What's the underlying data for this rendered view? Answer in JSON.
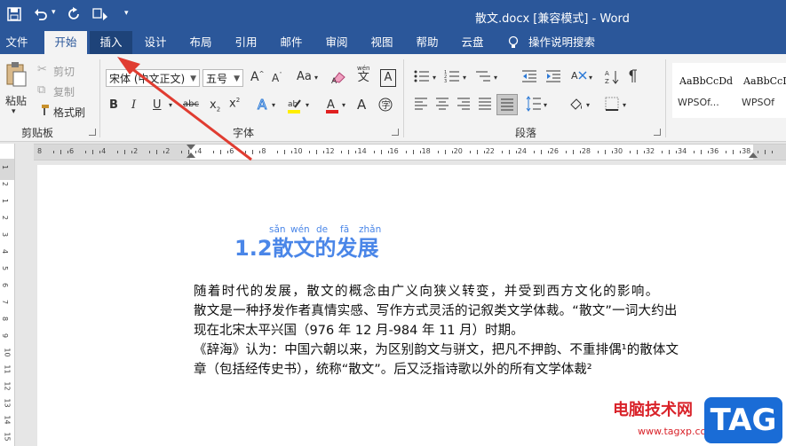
{
  "titlebar": {
    "title": "散文.docx [兼容模式] - Word",
    "save_icon": "save-icon",
    "undo_icon": "undo-icon",
    "redo_icon": "redo-icon"
  },
  "tabs": [
    "文件",
    "开始",
    "插入",
    "设计",
    "布局",
    "引用",
    "邮件",
    "审阅",
    "视图",
    "帮助",
    "云盘",
    "操作说明搜索"
  ],
  "ribbon": {
    "clipboard": {
      "label": "剪贴板",
      "paste": "粘贴",
      "cut": "剪切",
      "copy": "复制",
      "format_painter": "格式刷"
    },
    "font": {
      "label": "字体",
      "font_name": "宋体 (中文正文)",
      "font_size": "五号",
      "change_case": "Aa",
      "wen": "wén",
      "phonetic_char": "文",
      "border_char": "A"
    },
    "paragraph": {
      "label": "段落"
    },
    "styles": [
      {
        "sample": "AaBbCcDd",
        "name": "WPSOf..."
      },
      {
        "sample": "AaBbCcI",
        "name": "WPSOf"
      }
    ]
  },
  "ruler": {
    "top_numbers": [
      "8",
      "6",
      "4",
      "2",
      "2",
      "4",
      "6",
      "8",
      "10",
      "12",
      "14",
      "16",
      "18",
      "20",
      "22",
      "24",
      "26",
      "28",
      "30",
      "32",
      "34",
      "36",
      "38"
    ],
    "left_numbers": [
      "1",
      "2",
      "1",
      "2",
      "3",
      "4",
      "5",
      "6",
      "7",
      "8",
      "9",
      "10",
      "11",
      "12",
      "13",
      "14",
      "15"
    ]
  },
  "document": {
    "heading": "1.2散文的发展",
    "pinyin": [
      "sǎn",
      "wén",
      "de",
      "fā",
      "zhǎn"
    ],
    "lines": [
      "随着时代的发展，散文的概念由广义向狭义转变，并受到西方文化的影响。",
      "散文是一种抒发作者真情实感、写作方式灵活的记叙类文学体裁。“散文”一词大约出",
      "现在北宋太平兴国（976 年 12 月-984 年 11 月）时期。",
      "《辞海》认为：中国六朝以来，为区别韵文与骈文，把凡不押韵、不重排偶¹的散体文",
      "章（包括经传史书），统称“散文”。后又泛指诗歌以外的所有文学体裁²"
    ]
  },
  "watermark": {
    "site_name": "电脑技术网",
    "url": "www.tagxp.com",
    "badge": "TAG"
  },
  "colors": {
    "accent": "#2b579a",
    "heading_blue": "#4a86e8",
    "arrow_red": "#e03c31",
    "watermark_red": "#d9232a",
    "badge_blue": "#1a6cd6"
  }
}
